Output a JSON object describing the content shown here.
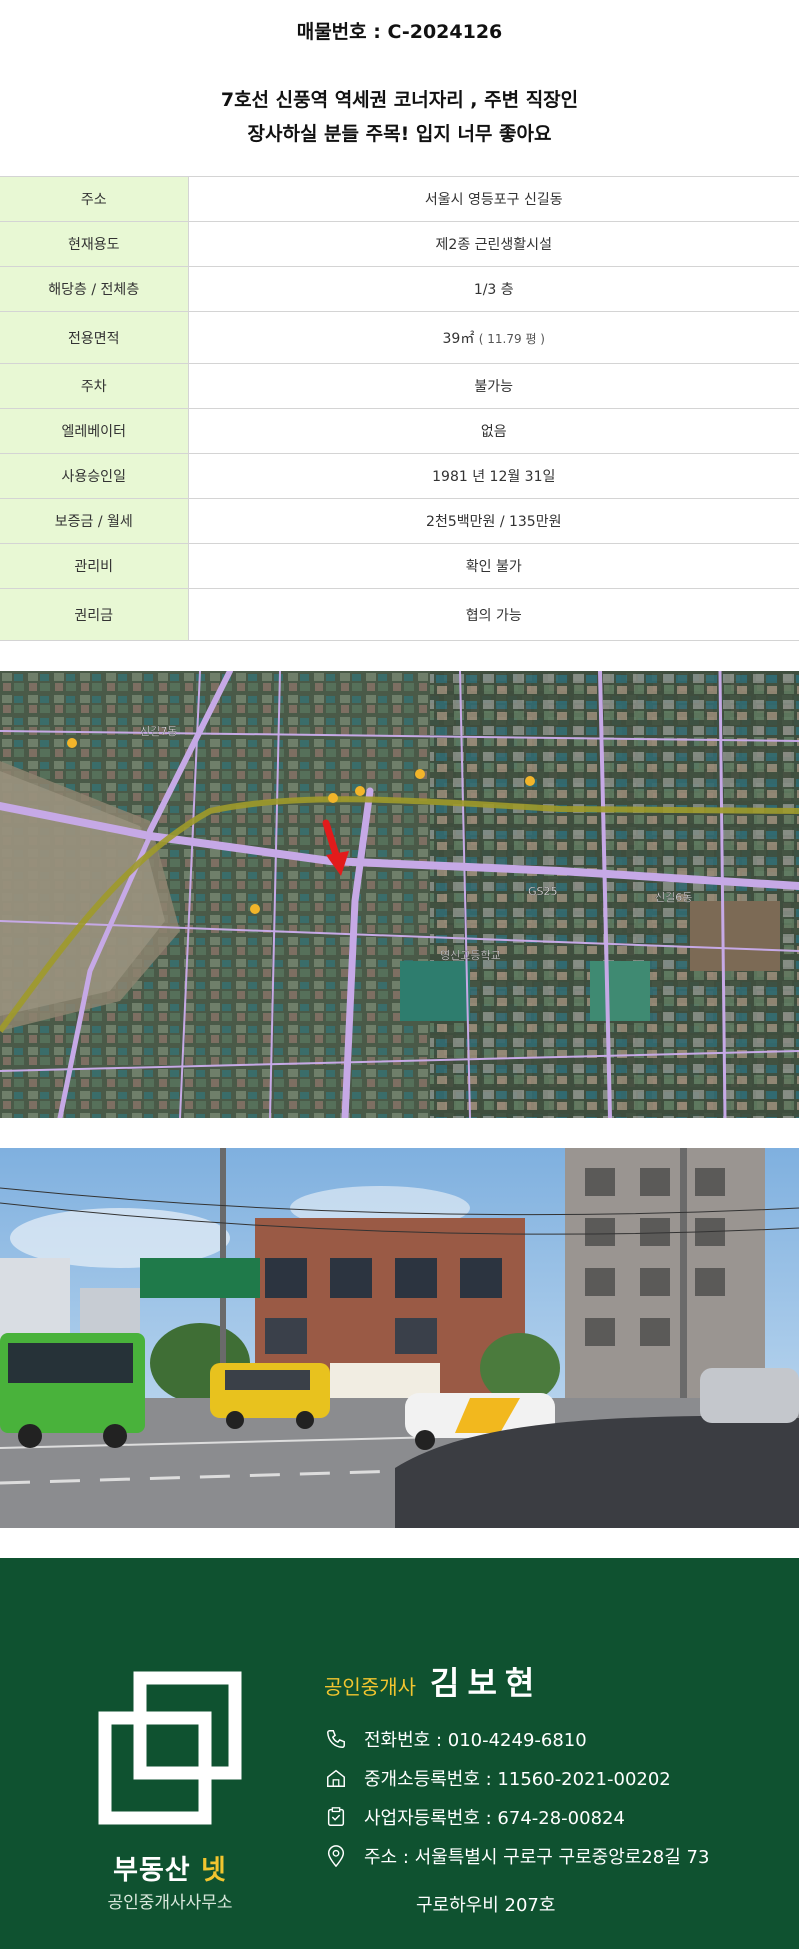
{
  "listing": {
    "number_label": "매물번호 : C-2024126",
    "headline_line1": "7호선  신풍역 역세권 코너자리 , 주변 직장인",
    "headline_line2": "장사하실 분들 주목! 입지 너무 좋아요"
  },
  "info_table": {
    "address_label": "주소",
    "address_value": "서울시 영등포구 신길동",
    "use_label": "현재용도",
    "use_value": "제2종  근린생활시설",
    "floor_label": "해당층 / 전체층",
    "floor_value": "1/3 층",
    "area_label": "전용면적",
    "area_value": "39",
    "area_unit": "㎡",
    "area_pyeong": "( 11.79 평 )",
    "parking_label": "주차",
    "parking_value": "불가능",
    "elevator_label": "엘레베이터",
    "elevator_value": "없음",
    "approval_label": "사용승인일",
    "approval_value": "1981 년 12월 31일",
    "deposit_label": "보증금 / 월세",
    "deposit_value": "2천5백만원  / 135만원",
    "maintenance_label": "관리비",
    "maintenance_value": "확인 불가",
    "premium_label": "권리금",
    "premium_value": "협의 가능"
  },
  "map": {
    "labels": {
      "station_left": "신길7동",
      "station_right": "신길6동",
      "gs25": "GS25",
      "school": "영신고등학교"
    }
  },
  "footer": {
    "brand_main": "부동산 ",
    "brand_accent": "넷",
    "brand_sub": "공인중개사사무소",
    "agent_title": "공인중개사",
    "agent_name": "김보현",
    "phone": "전화번호 : 010-4249-6810",
    "broker_reg": "중개소등록번호 : 11560-2021-00202",
    "business_reg": "사업자등록번호 : 674-28-00824",
    "address_line1": "주소 : 서울특별시 구로구 구로중앙로28길 73",
    "address_line2": "구로하우비 207호"
  },
  "colors": {
    "label_bg": "#e8f8d4",
    "footer_bg": "#0f5230",
    "accent_yellow": "#f2c52f"
  },
  "icons": [
    "phone-icon",
    "building-icon",
    "clipboard-icon",
    "location-pin-icon",
    "overlapping-squares-logo"
  ]
}
